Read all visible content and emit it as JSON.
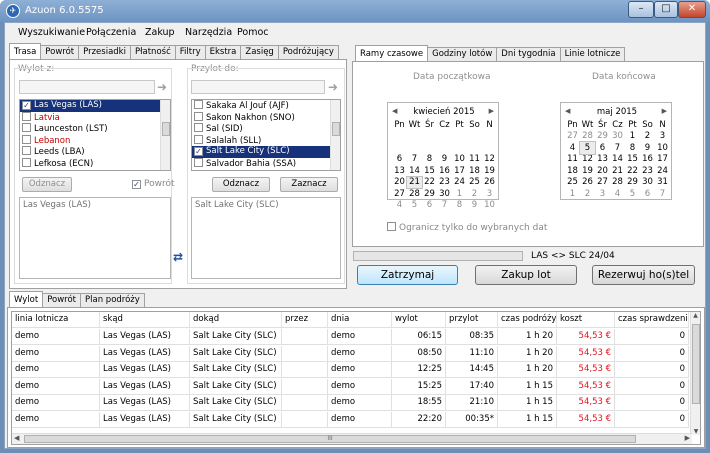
{
  "window": {
    "title": "Azuon 6.0.5575",
    "icon": "azuon-logo-icon"
  },
  "menu": [
    "Wyszukiwanie",
    "Połączenia",
    "Zakup",
    "Narzędzia",
    "Pomoc"
  ],
  "left_tabs": [
    "Trasa",
    "Powrót",
    "Przesiadki",
    "Płatność",
    "Filtry",
    "Ekstra",
    "Zasięg",
    "Podróżujący"
  ],
  "departure": {
    "label": "Wylot z:",
    "items": [
      {
        "text": "Las Vegas (LAS)",
        "checked": true,
        "selected": true,
        "red": false
      },
      {
        "text": "Latvia",
        "checked": false,
        "selected": false,
        "red": true
      },
      {
        "text": "Launceston (LST)",
        "checked": false,
        "selected": false,
        "red": false
      },
      {
        "text": "Lebanon",
        "checked": false,
        "selected": false,
        "red": true
      },
      {
        "text": "Leeds (LBA)",
        "checked": false,
        "selected": false,
        "red": false
      },
      {
        "text": "Lefkosa (ECN)",
        "checked": false,
        "selected": false,
        "red": false
      }
    ],
    "clear_button": "Odznacz",
    "return_label": "Powrót",
    "selection_text": "Las Vegas (LAS)"
  },
  "arrival": {
    "label": "Przylot do:",
    "items": [
      {
        "text": "Sakaka Al Jouf (AJF)",
        "checked": false,
        "selected": false,
        "red": false
      },
      {
        "text": "Sakon Nakhon (SNO)",
        "checked": false,
        "selected": false,
        "red": false
      },
      {
        "text": "Sal (SID)",
        "checked": false,
        "selected": false,
        "red": false
      },
      {
        "text": "Salalah (SLL)",
        "checked": false,
        "selected": false,
        "red": false
      },
      {
        "text": "Salt Lake City (SLC)",
        "checked": true,
        "selected": true,
        "red": false
      },
      {
        "text": "Salvador Bahia (SSA)",
        "checked": false,
        "selected": false,
        "red": false
      }
    ],
    "clear_button": "Odznacz",
    "select_button": "Zaznacz",
    "selection_text": "Salt Lake City (SLC)"
  },
  "right_tabs": [
    "Ramy czasowe",
    "Godziny lotów",
    "Dni tygodnia",
    "Linie lotnicze"
  ],
  "start_date": {
    "label": "Data początkowa",
    "month": "kwiecień 2015",
    "weekdays": [
      "Pn",
      "Wt",
      "Śr",
      "Cz",
      "Pt",
      "So",
      "N"
    ],
    "weeks": [
      [
        "",
        "",
        "",
        "",
        "",
        "",
        ""
      ],
      [
        "",
        "",
        "",
        "",
        "",
        "",
        ""
      ],
      [
        "6",
        "7",
        "8",
        "9",
        "10",
        "11",
        "12"
      ],
      [
        "13",
        "14",
        "15",
        "16",
        "17",
        "18",
        "19"
      ],
      [
        "20",
        "21",
        "22",
        "23",
        "24",
        "25",
        "26"
      ],
      [
        "27",
        "28",
        "29",
        "30",
        "1",
        "2",
        "3"
      ],
      [
        "4",
        "5",
        "6",
        "7",
        "8",
        "9",
        "10"
      ]
    ],
    "today": "21"
  },
  "end_date": {
    "label": "Data końcowa",
    "month": "maj 2015",
    "weekdays": [
      "Pn",
      "Wt",
      "Śr",
      "Cz",
      "Pt",
      "So",
      "N"
    ],
    "weeks": [
      [
        "27",
        "28",
        "29",
        "30",
        "1",
        "2",
        "3"
      ],
      [
        "4",
        "5",
        "6",
        "7",
        "8",
        "9",
        "10"
      ],
      [
        "11",
        "12",
        "13",
        "14",
        "15",
        "16",
        "17"
      ],
      [
        "18",
        "19",
        "20",
        "21",
        "22",
        "23",
        "24"
      ],
      [
        "25",
        "26",
        "27",
        "28",
        "29",
        "30",
        "31"
      ],
      [
        "1",
        "2",
        "3",
        "4",
        "5",
        "6",
        "7"
      ]
    ],
    "today": "5"
  },
  "limit_label": "Ogranicz tylko do wybranych dat",
  "progress": {
    "status_text": "LAS <> SLC 24/04",
    "value": 0
  },
  "buttons": {
    "stop": "Zatrzymaj",
    "buy": "Zakup lot",
    "reserve": "Rezerwuj ho(s)tel"
  },
  "result_tabs": [
    "Wylot",
    "Powrót",
    "Plan podróży"
  ],
  "columns": [
    "linia lotnicza",
    "skąd",
    "dokąd",
    "przez",
    "dnia",
    "wylot",
    "przylot",
    "czas podróży",
    "koszt",
    "czas sprawdzenia"
  ],
  "rows": [
    [
      "demo",
      "Las Vegas (LAS)",
      "Salt Lake City (SLC)",
      "",
      "demo",
      "06:15",
      "08:35",
      "1 h 20",
      "54,53 €",
      "0"
    ],
    [
      "demo",
      "Las Vegas (LAS)",
      "Salt Lake City (SLC)",
      "",
      "demo",
      "08:50",
      "11:10",
      "1 h 20",
      "54,53 €",
      "0"
    ],
    [
      "demo",
      "Las Vegas (LAS)",
      "Salt Lake City (SLC)",
      "",
      "demo",
      "12:25",
      "14:45",
      "1 h 20",
      "54,53 €",
      "0"
    ],
    [
      "demo",
      "Las Vegas (LAS)",
      "Salt Lake City (SLC)",
      "",
      "demo",
      "15:25",
      "17:40",
      "1 h 15",
      "54,53 €",
      "0"
    ],
    [
      "demo",
      "Las Vegas (LAS)",
      "Salt Lake City (SLC)",
      "",
      "demo",
      "18:55",
      "21:10",
      "1 h 15",
      "54,53 €",
      "0"
    ],
    [
      "demo",
      "Las Vegas (LAS)",
      "Salt Lake City (SLC)",
      "",
      "demo",
      "22:20",
      "00:35*",
      "1 h 15",
      "54,53 €",
      "0"
    ]
  ],
  "hscroll_grip": "III"
}
